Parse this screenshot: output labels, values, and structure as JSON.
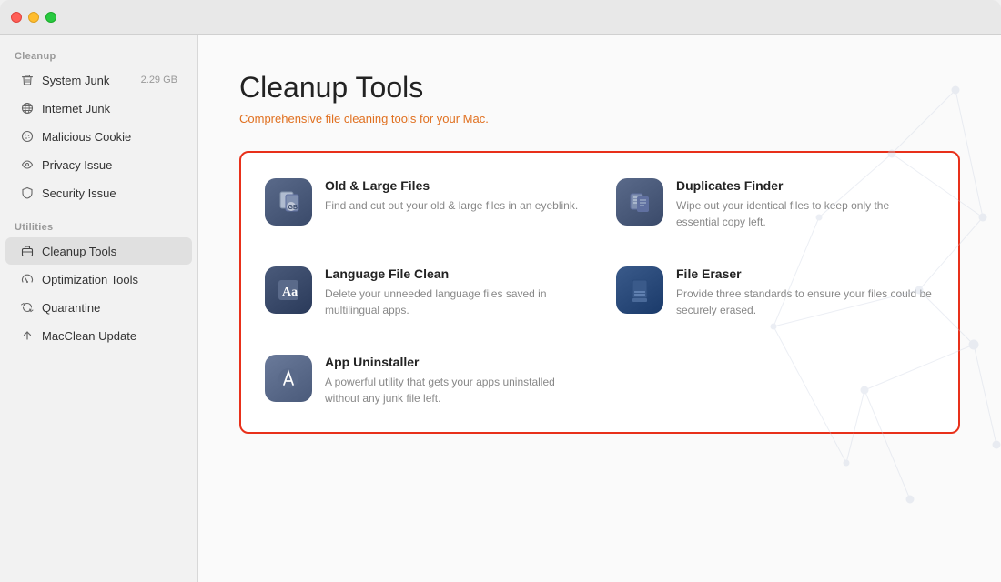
{
  "window": {
    "traffic_lights": {
      "close": "close",
      "minimize": "minimize",
      "maximize": "maximize"
    }
  },
  "sidebar": {
    "cleanup_label": "Cleanup",
    "utilities_label": "Utilities",
    "items_cleanup": [
      {
        "id": "system-junk",
        "label": "System Junk",
        "badge": "2.29 GB",
        "icon": "trash"
      },
      {
        "id": "internet-junk",
        "label": "Internet Junk",
        "badge": "",
        "icon": "globe"
      },
      {
        "id": "malicious-cookie",
        "label": "Malicious Cookie",
        "badge": "",
        "icon": "clock"
      },
      {
        "id": "privacy-issue",
        "label": "Privacy Issue",
        "badge": "",
        "icon": "eye"
      },
      {
        "id": "security-issue",
        "label": "Security Issue",
        "badge": "",
        "icon": "shield"
      }
    ],
    "items_utilities": [
      {
        "id": "cleanup-tools",
        "label": "Cleanup Tools",
        "badge": "",
        "icon": "briefcase",
        "active": true
      },
      {
        "id": "optimization-tools",
        "label": "Optimization Tools",
        "badge": "",
        "icon": "gauge"
      },
      {
        "id": "quarantine",
        "label": "Quarantine",
        "badge": "",
        "icon": "refresh"
      },
      {
        "id": "macclean-update",
        "label": "MacClean Update",
        "badge": "",
        "icon": "arrow-up"
      }
    ]
  },
  "main": {
    "title": "Cleanup Tools",
    "subtitle": "Comprehensive file cleaning tools for your Mac.",
    "tools": [
      {
        "id": "old-large-files",
        "name": "Old & Large Files",
        "description": "Find and cut out your old & large files in an eyeblink.",
        "icon_type": "old-files"
      },
      {
        "id": "duplicates-finder",
        "name": "Duplicates Finder",
        "description": "Wipe out your identical files to keep only the essential copy left.",
        "icon_type": "duplicates"
      },
      {
        "id": "language-file-clean",
        "name": "Language File Clean",
        "description": "Delete your unneeded language files saved in multilingual apps.",
        "icon_type": "language"
      },
      {
        "id": "file-eraser",
        "name": "File Eraser",
        "description": "Provide three standards to ensure your files could be securely erased.",
        "icon_type": "eraser"
      },
      {
        "id": "app-uninstaller",
        "name": "App Uninstaller",
        "description": "A powerful utility that gets your apps uninstalled without any junk file left.",
        "icon_type": "uninstaller"
      }
    ]
  }
}
